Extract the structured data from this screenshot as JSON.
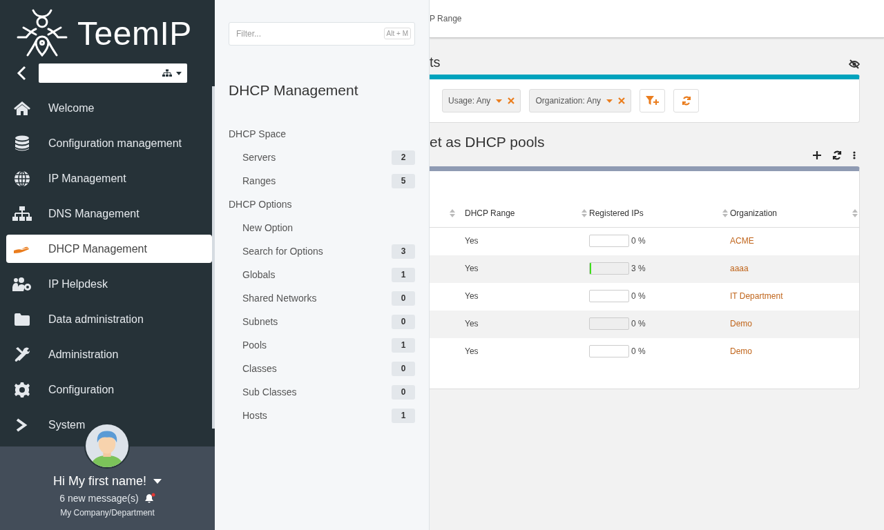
{
  "sidebar": {
    "logo": "TeemIP",
    "items": [
      {
        "label": "Welcome",
        "selected": false
      },
      {
        "label": "Configuration management",
        "selected": false
      },
      {
        "label": "IP Management",
        "selected": false
      },
      {
        "label": "DNS Management",
        "selected": false
      },
      {
        "label": "DHCP Management",
        "selected": true
      },
      {
        "label": "IP Helpdesk",
        "selected": false
      },
      {
        "label": "Data administration",
        "selected": false
      },
      {
        "label": "Administration",
        "selected": false
      },
      {
        "label": "Configuration",
        "selected": false
      },
      {
        "label": "System",
        "selected": false
      }
    ],
    "user": {
      "greeting": "Hi My first name!",
      "messages": "6 new message(s)",
      "organization": "My Company/Department"
    }
  },
  "menu_panel": {
    "filter": {
      "placeholder": "Filter...",
      "shortcut": "Alt + M"
    },
    "title": "DHCP Management",
    "groups": [
      {
        "label": "DHCP Space",
        "children": [
          {
            "label": "Servers",
            "count": "2"
          },
          {
            "label": "Ranges",
            "count": "5"
          }
        ]
      },
      {
        "label": "DHCP Options",
        "children": [
          {
            "label": "New Option"
          },
          {
            "label": "Search for Options",
            "count": "3"
          },
          {
            "label": "Globals",
            "count": "1"
          },
          {
            "label": "Shared Networks",
            "count": "0"
          },
          {
            "label": "Subnets",
            "count": "0"
          },
          {
            "label": "Pools",
            "count": "1"
          },
          {
            "label": "Classes",
            "count": "0"
          },
          {
            "label": "Sub Classes",
            "count": "0"
          },
          {
            "label": "Hosts",
            "count": "1"
          }
        ]
      }
    ]
  },
  "breadcrumb": "P Range",
  "search_panel": {
    "title": "ts",
    "criteria": [
      {
        "label": "Usage: Any"
      },
      {
        "label": "Organization: Any"
      }
    ]
  },
  "list": {
    "title": "et as DHCP pools",
    "columns": [
      "DHCP Range",
      "Registered IPs",
      "Organization"
    ],
    "rows": [
      {
        "dhcp_range": "Yes",
        "registered_ips": {
          "level": 0,
          "reading": "0 %"
        },
        "organization": "ACME"
      },
      {
        "dhcp_range": "Yes",
        "registered_ips": {
          "level": 0.03,
          "reading": "3 %"
        },
        "organization": "aaaa"
      },
      {
        "dhcp_range": "Yes",
        "registered_ips": {
          "level": 0,
          "reading": "0 %"
        },
        "organization": "IT Department"
      },
      {
        "dhcp_range": "Yes",
        "registered_ips": {
          "level": 0,
          "reading": "0 %"
        },
        "organization": "Demo"
      },
      {
        "dhcp_range": "Yes",
        "registered_ips": {
          "level": 0,
          "reading": "0 %"
        },
        "organization": "Demo"
      }
    ]
  }
}
